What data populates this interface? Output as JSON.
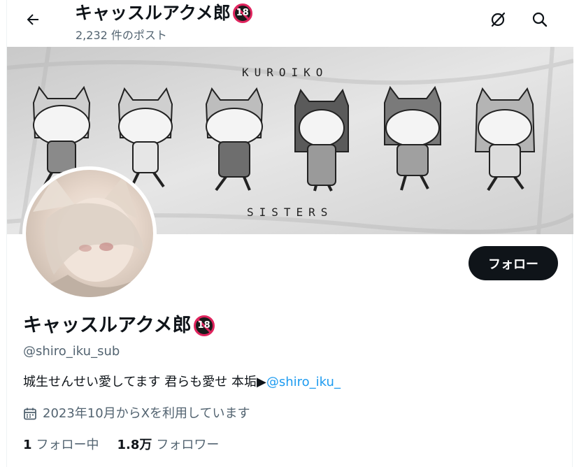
{
  "header": {
    "title": "キャッスルアクメ郎",
    "badge": "18",
    "subtitle": "2,232 件のポスト"
  },
  "banner": {
    "top_text": "KUROIKO",
    "bottom_text": "SISTERS"
  },
  "profile": {
    "display_name": "キャッスルアクメ郎",
    "badge": "18",
    "handle": "@shiro_iku_sub",
    "bio_text": "城生せんせい愛してます 君らも愛せ 本垢▶",
    "bio_link": "@shiro_iku_",
    "joined": "2023年10月からXを利用しています",
    "follow_label": "フォロー"
  },
  "stats": {
    "following_count": "1",
    "following_label": "フォロー中",
    "followers_count": "1.8万",
    "followers_label": "フォロワー"
  },
  "icons": [
    "back-arrow-icon",
    "grok-icon",
    "search-icon",
    "calendar-icon"
  ]
}
